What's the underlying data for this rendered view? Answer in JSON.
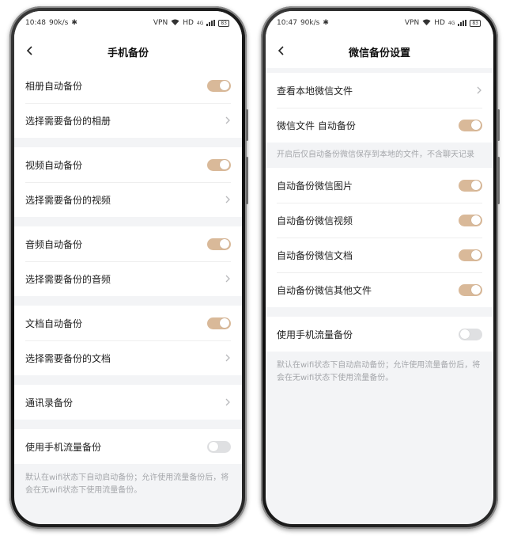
{
  "left": {
    "status": {
      "time": "10:48",
      "speed": "90k/s",
      "vpn": "VPN",
      "hd": "HD",
      "net": "4G",
      "battery": "83"
    },
    "nav_title": "手机备份",
    "groups": [
      [
        {
          "label": "相册自动备份",
          "control": "toggle",
          "state": "on"
        },
        {
          "label": "选择需要备份的相册",
          "control": "chevron"
        }
      ],
      [
        {
          "label": "视频自动备份",
          "control": "toggle",
          "state": "on"
        },
        {
          "label": "选择需要备份的视频",
          "control": "chevron"
        }
      ],
      [
        {
          "label": "音频自动备份",
          "control": "toggle",
          "state": "on"
        },
        {
          "label": "选择需要备份的音频",
          "control": "chevron"
        }
      ],
      [
        {
          "label": "文档自动备份",
          "control": "toggle",
          "state": "on"
        },
        {
          "label": "选择需要备份的文档",
          "control": "chevron"
        }
      ],
      [
        {
          "label": "通讯录备份",
          "control": "chevron"
        }
      ],
      [
        {
          "label": "使用手机流量备份",
          "control": "toggle",
          "state": "off"
        }
      ]
    ],
    "footer_note": "默认在wifi状态下自动启动备份；允许使用流量备份后，将会在无wifi状态下使用流量备份。"
  },
  "right": {
    "status": {
      "time": "10:47",
      "speed": "90k/s",
      "vpn": "VPN",
      "hd": "HD",
      "net": "4G",
      "battery": "83"
    },
    "nav_title": "微信备份设置",
    "view_local": "查看本地微信文件",
    "wechat_auto": "微信文件 自动备份",
    "wechat_note": "开启后仅自动备份微信保存到本地的文件，不含聊天记录",
    "auto_items": [
      "自动备份微信图片",
      "自动备份微信视频",
      "自动备份微信文档",
      "自动备份微信其他文件"
    ],
    "mobile_data": "使用手机流量备份",
    "footer_note": "默认在wifi状态下自动启动备份；允许使用流量备份后，将会在无wifi状态下使用流量备份。"
  },
  "colors": {
    "toggle_on": "#d9b999",
    "toggle_off": "#dfe0e2",
    "note_text": "#a5a7ab",
    "page_bg": "#f3f4f6"
  },
  "icons": {
    "back": "chevron-left-icon",
    "row_arrow": "chevron-right-icon",
    "bluetooth": "bluetooth-icon",
    "wifi": "wifi-icon",
    "signal": "signal-icon",
    "battery": "battery-icon"
  }
}
